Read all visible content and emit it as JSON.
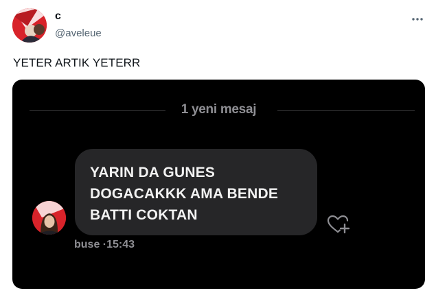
{
  "tweet": {
    "display_name": "c",
    "handle": "@aveleue",
    "text": "YETER ARTIK YETERR"
  },
  "icons": {
    "more": "more-options-icon",
    "react": "heart-plus-icon"
  },
  "media": {
    "separator_label": "1 yeni mesaj",
    "message_lines": [
      "YARIN DA GUNES",
      "DOGACAKKK AMA BENDE",
      "BATTI COKTAN"
    ],
    "sender": "buse",
    "dot": "·",
    "time": "15:43"
  },
  "colors": {
    "media_background": "#000000",
    "bubble": "#262628",
    "brand_red": "#d8232a"
  }
}
